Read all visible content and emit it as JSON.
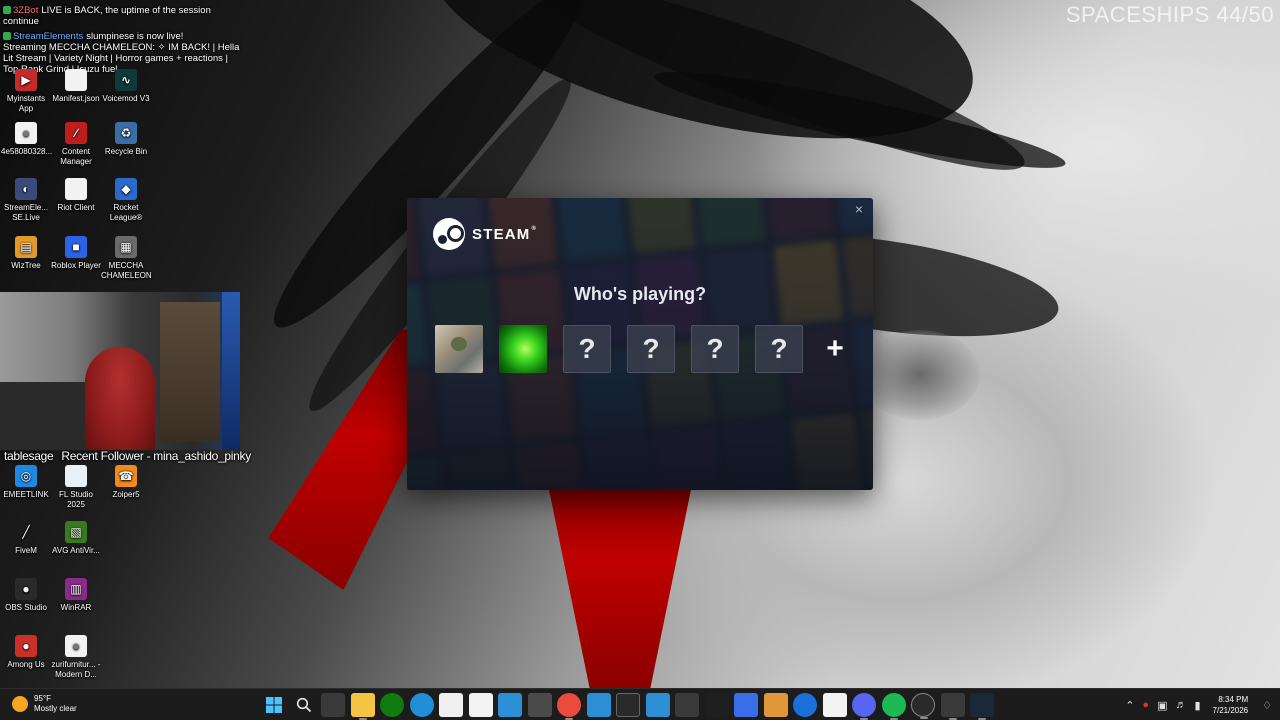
{
  "overlay": {
    "chat": {
      "line1_bot": "3ZBot",
      "line1_text": "LIVE is BACK, the uptime of the session continue",
      "line2_chan": "StreamElements",
      "line2_text": "slumpinese is now live!",
      "line3_text": "Streaming MECCHA CHAMELEON: ✧ IM BACK! | Hella Lit Stream | Variety Night | Horror games + reactions | Top Rank Grind | Isuzu fuel"
    },
    "spaceships_counter": "SPACESHIPS 44/50",
    "webcam_caption": {
      "name": "tablesage",
      "follower": "Recent Follower - mina_ashido_pinky"
    }
  },
  "desktop_icons": [
    {
      "label": "Myinstants App",
      "icon": "myinstants-icon",
      "color": "#c62b2b",
      "glyph": "▶"
    },
    {
      "label": "Manifest.json",
      "icon": "file-icon",
      "color": "#f2f2f2",
      "glyph": ""
    },
    {
      "label": "Voicemod V3",
      "icon": "voicemod-icon",
      "color": "#0f3a3a",
      "glyph": "∿"
    },
    {
      "label": "4e58080328...",
      "icon": "chrome-icon",
      "color": "#f2f2f2",
      "glyph": "●"
    },
    {
      "label": "Content Manager",
      "icon": "content-manager-icon",
      "color": "#c01d1d",
      "glyph": "∕"
    },
    {
      "label": "Recycle Bin",
      "icon": "recycle-bin-icon",
      "color": "#3a6ea8",
      "glyph": "♻"
    },
    {
      "label": "StreamEle... SE.Live",
      "icon": "streamelements-icon",
      "color": "#3a4a7a",
      "glyph": "◐"
    },
    {
      "label": "Riot Client",
      "icon": "riot-client-icon",
      "color": "#f2f2f2",
      "glyph": ""
    },
    {
      "label": "Rocket League®",
      "icon": "rocket-league-icon",
      "color": "#2a6acb",
      "glyph": "◆"
    },
    {
      "label": "WizTree",
      "icon": "wiztree-icon",
      "color": "#e09a2a",
      "glyph": "▤"
    },
    {
      "label": "Roblox Player",
      "icon": "roblox-icon",
      "color": "#2a62e8",
      "glyph": "■"
    },
    {
      "label": "MECCHA CHAMELEON",
      "icon": "meccha-chameleon-icon",
      "color": "#6b6b6b",
      "glyph": "▦"
    },
    {
      "label": "EMEETLINK",
      "icon": "emeetlink-icon",
      "color": "#1e88e5",
      "glyph": "◎"
    },
    {
      "label": "FL Studio 2025",
      "icon": "fl-studio-icon",
      "color": "#e8f0f8",
      "glyph": ""
    },
    {
      "label": "Zoiper5",
      "icon": "zoiper-icon",
      "color": "#f08a1a",
      "glyph": "☎"
    },
    {
      "label": "FiveM",
      "icon": "fivem-icon",
      "color": "#1a1a1a",
      "glyph": "╱"
    },
    {
      "label": "AVG AntiVir...",
      "icon": "avg-icon",
      "color": "#3a7a1e",
      "glyph": "▧"
    },
    {
      "label": "OBS Studio",
      "icon": "obs-icon",
      "color": "#2a2a2a",
      "glyph": "●"
    },
    {
      "label": "WinRAR",
      "icon": "winrar-icon",
      "color": "#8a2a8a",
      "glyph": "▥"
    },
    {
      "label": "Among Us",
      "icon": "among-us-icon",
      "color": "#c8302a",
      "glyph": "●"
    },
    {
      "label": "zurifurnitur... - Modern D...",
      "icon": "chrome-shortcut-icon",
      "color": "#f2f2f2",
      "glyph": "●"
    }
  ],
  "steam": {
    "brand": "STEAM",
    "trademark": "®",
    "close_glyph": "×",
    "title": "Who's playing?",
    "unknown_glyph": "?",
    "add_glyph": "+"
  },
  "taskbar": {
    "weather_temp": "95°F",
    "weather_desc": "Mostly clear",
    "time": "8:34 PM",
    "date": "7/21/2026"
  }
}
